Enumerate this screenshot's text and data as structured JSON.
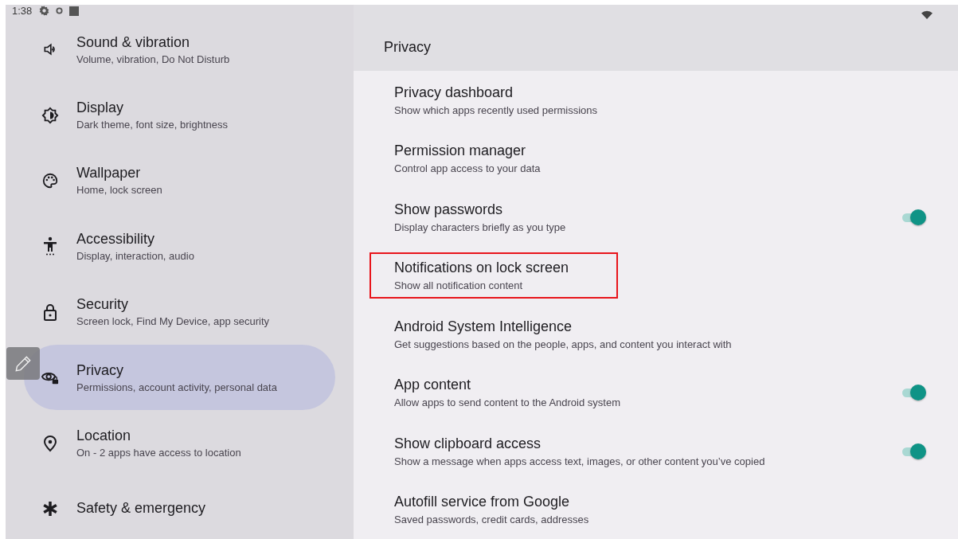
{
  "status_bar": {
    "time": "1:38"
  },
  "sidebar": {
    "items": [
      {
        "title": "Sound & vibration",
        "subtitle": "Volume, vibration, Do Not Disturb",
        "selected": false
      },
      {
        "title": "Display",
        "subtitle": "Dark theme, font size, brightness",
        "selected": false
      },
      {
        "title": "Wallpaper",
        "subtitle": "Home, lock screen",
        "selected": false
      },
      {
        "title": "Accessibility",
        "subtitle": "Display, interaction, audio",
        "selected": false
      },
      {
        "title": "Security",
        "subtitle": "Screen lock, Find My Device, app security",
        "selected": false
      },
      {
        "title": "Privacy",
        "subtitle": "Permissions, account activity, personal data",
        "selected": true
      },
      {
        "title": "Location",
        "subtitle": "On - 2 apps have access to location",
        "selected": false
      },
      {
        "title": "Safety & emergency",
        "selected": false
      }
    ]
  },
  "page": {
    "title": "Privacy",
    "items": [
      {
        "title": "Privacy dashboard",
        "subtitle": "Show which apps recently used permissions",
        "highlighted": false
      },
      {
        "title": "Permission manager",
        "subtitle": "Control app access to your data",
        "highlighted": false
      },
      {
        "title": "Show passwords",
        "subtitle": "Display characters briefly as you type",
        "highlighted": false,
        "kind": "toggle",
        "on": true
      },
      {
        "title": "Notifications on lock screen",
        "subtitle": "Show all notification content",
        "highlighted": true
      },
      {
        "title": "Android System Intelligence",
        "subtitle": "Get suggestions based on the people, apps, and content you interact with",
        "highlighted": false
      },
      {
        "title": "App content",
        "subtitle": "Allow apps to send content to the Android system",
        "highlighted": false,
        "kind": "toggle",
        "on": true
      },
      {
        "title": "Show clipboard access",
        "subtitle": "Show a message when apps access text, images, or other content you’ve copied",
        "highlighted": false,
        "kind": "toggle",
        "on": true
      },
      {
        "title": "Autofill service from Google",
        "subtitle": "Saved passwords, credit cards, addresses",
        "highlighted": false
      }
    ]
  }
}
